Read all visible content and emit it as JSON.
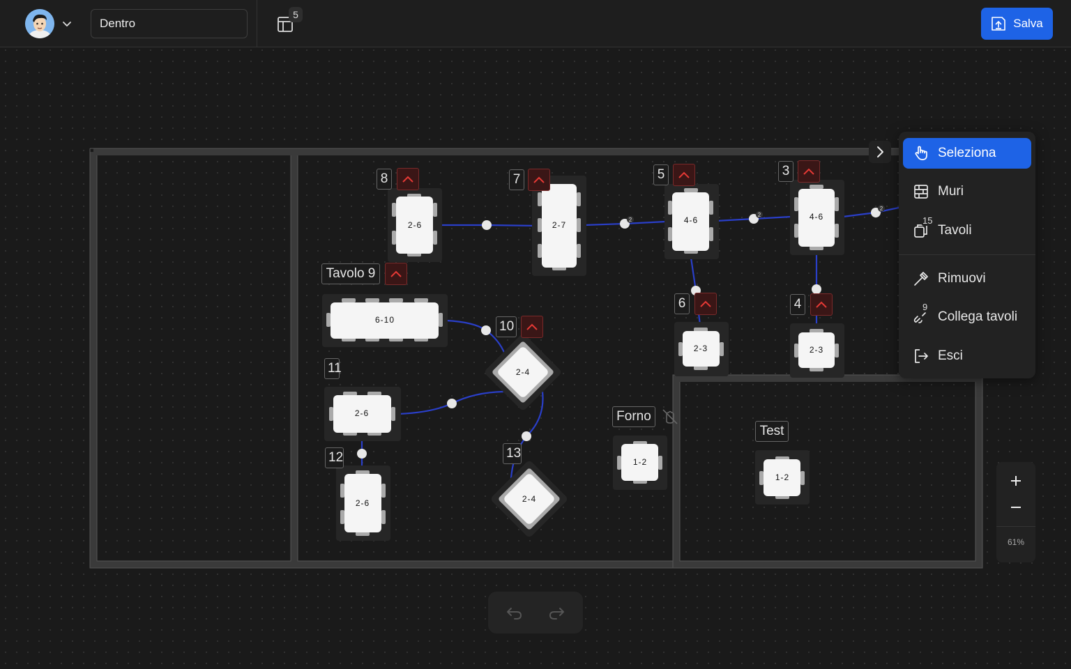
{
  "header": {
    "room_name": "Dentro",
    "layout_count": "5",
    "save_label": "Salva"
  },
  "colors": {
    "accent": "#1e63e6",
    "connection_line": "#2a3fc9",
    "warning_red": "#e53935",
    "table_fill": "#f5f5f5"
  },
  "tables": [
    {
      "label": "8",
      "capacity": "2-6"
    },
    {
      "label": "7",
      "capacity": "2-7"
    },
    {
      "label": "5",
      "capacity": "4-6"
    },
    {
      "label": "3",
      "capacity": "4-6"
    },
    {
      "label": "Tavolo 9",
      "capacity": "6-10"
    },
    {
      "label": "10",
      "capacity": "2-4"
    },
    {
      "label": "6",
      "capacity": "2-3"
    },
    {
      "label": "4",
      "capacity": "2-3"
    },
    {
      "label": "11",
      "capacity": "2-6"
    },
    {
      "label": "12",
      "capacity": "2-6"
    },
    {
      "label": "13",
      "capacity": "2-4"
    },
    {
      "label": "Forno",
      "capacity": "1-2"
    },
    {
      "label": "Test",
      "capacity": "1-2"
    }
  ],
  "connection_counts": [
    "2",
    "2",
    "2"
  ],
  "menu": {
    "items": [
      {
        "label": "Seleziona",
        "icon": "pointer-hand-icon",
        "badge": ""
      },
      {
        "label": "Muri",
        "icon": "wall-grid-icon",
        "badge": ""
      },
      {
        "label": "Tavoli",
        "icon": "tables-icon",
        "badge": "15"
      },
      {
        "label": "Rimuovi",
        "icon": "hammer-icon",
        "badge": ""
      },
      {
        "label": "Collega tavoli",
        "icon": "link-icon",
        "badge": "9"
      },
      {
        "label": "Esci",
        "icon": "logout-icon",
        "badge": ""
      }
    ]
  },
  "zoom": {
    "level": "61%"
  }
}
